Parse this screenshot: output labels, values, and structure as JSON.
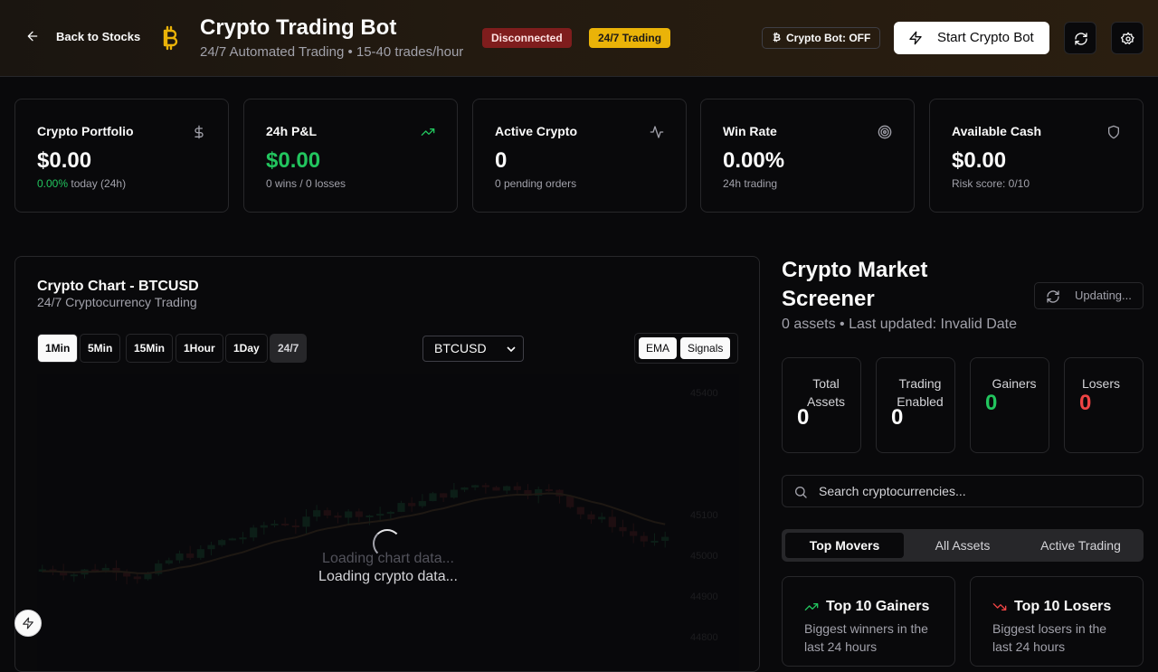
{
  "header": {
    "back_label": "Back to Stocks",
    "title": "Crypto Trading Bot",
    "subtitle": "24/7 Automated Trading • 15-40 trades/hour",
    "badge_connection": "Disconnected",
    "badge_mode": "24/7 Trading",
    "bot_status": "Crypto Bot: OFF",
    "bot_status_symbol": "₿",
    "start_button": "Start Crypto Bot"
  },
  "stats": [
    {
      "label": "Crypto Portfolio",
      "value": "$0.00",
      "sub_highlight": "0.00%",
      "sub": " today (24h)",
      "icon": "dollar-icon"
    },
    {
      "label": "24h P&L",
      "value": "$0.00",
      "sub": "0 wins / 0 losses",
      "icon": "trending-up-icon"
    },
    {
      "label": "Active Crypto",
      "value": "0",
      "sub": "0 pending orders",
      "icon": "activity-icon"
    },
    {
      "label": "Win Rate",
      "value": "0.00%",
      "sub": "24h trading",
      "icon": "target-icon"
    },
    {
      "label": "Available Cash",
      "value": "$0.00",
      "sub": "Risk score: 0/10",
      "icon": "shield-icon"
    }
  ],
  "chart": {
    "title": "Crypto Chart - BTCUSD",
    "subtitle": "24/7 Cryptocurrency Trading",
    "timeframes": [
      "1Min",
      "5Min",
      "15Min",
      "1Hour",
      "1Day"
    ],
    "tag": "24/7",
    "symbol": "BTCUSD",
    "toggle_ema": "EMA",
    "toggle_signals": "Signals",
    "loading_chart": "Loading chart data...",
    "loading_crypto": "Loading crypto data..."
  },
  "chart_data": {
    "type": "candlestick",
    "ylim": [
      44800,
      45400
    ],
    "yticks": [
      "45400",
      "45100",
      "45000",
      "44900",
      "44800"
    ]
  },
  "screener": {
    "title": "Crypto Market Screener",
    "updating": "Updating...",
    "subtitle": "0 assets • Last updated: Invalid Date",
    "stats": [
      {
        "label": "Total Assets",
        "value": "0"
      },
      {
        "label": "Trading Enabled",
        "value": "0"
      },
      {
        "label": "Gainers",
        "value": "0"
      },
      {
        "label": "Losers",
        "value": "0"
      }
    ],
    "search_placeholder": "Search cryptocurrencies...",
    "tabs": [
      "Top Movers",
      "All Assets",
      "Active Trading"
    ],
    "gainers_title": "Top 10 Gainers",
    "gainers_desc": "Biggest winners in the last 24 hours",
    "losers_title": "Top 10 Losers",
    "losers_desc": "Biggest losers in the last 24 hours"
  },
  "colors": {
    "accent": "#eab308",
    "gain": "#22c55e",
    "loss": "#ef4444",
    "danger_badge": "#7f1d1d"
  }
}
